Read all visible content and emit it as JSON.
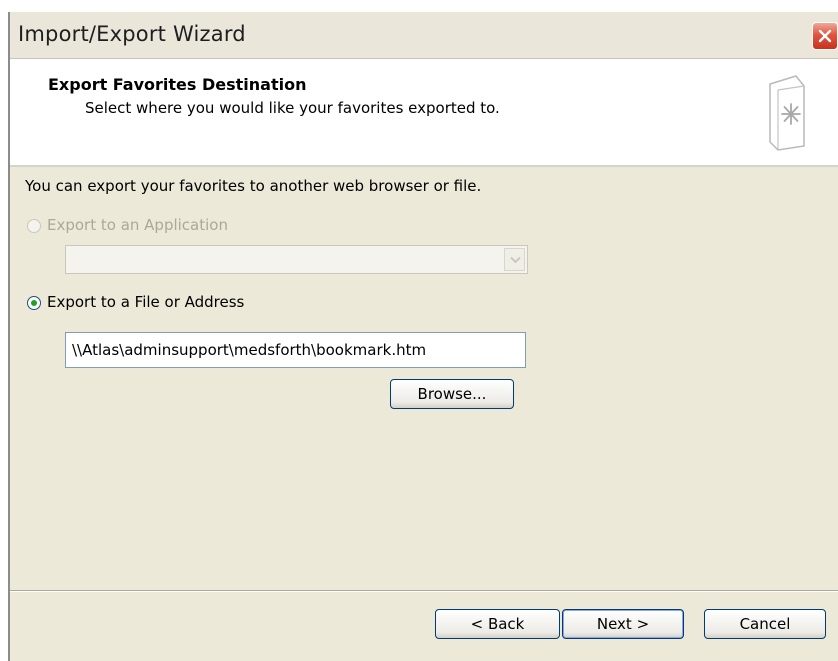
{
  "window": {
    "title": "Import/Export Wizard"
  },
  "header": {
    "title": "Export Favorites Destination",
    "subtitle": "Select where you would like your favorites exported to."
  },
  "body": {
    "intro": "You can export your favorites to another web browser or file.",
    "option_application": {
      "label": "Export to an Application",
      "selected": false,
      "enabled": false,
      "dropdown_value": ""
    },
    "option_file": {
      "label": "Export to a File or Address",
      "selected": true,
      "enabled": true,
      "path": "\\\\Atlas\\adminsupport\\medsforth\\bookmark.htm"
    },
    "browse_label": "Browse..."
  },
  "footer": {
    "back_label": "< Back",
    "next_label": "Next >",
    "cancel_label": "Cancel"
  },
  "icons": {
    "close": "close-icon",
    "header": "favorites-document-icon",
    "dropdown": "chevron-down-icon"
  },
  "colors": {
    "dialog_bg": "#ece9d8",
    "header_bg": "#ffffff",
    "close_button": "#e0553f",
    "radio_selected": "#21a121",
    "button_border": "#003c74"
  }
}
